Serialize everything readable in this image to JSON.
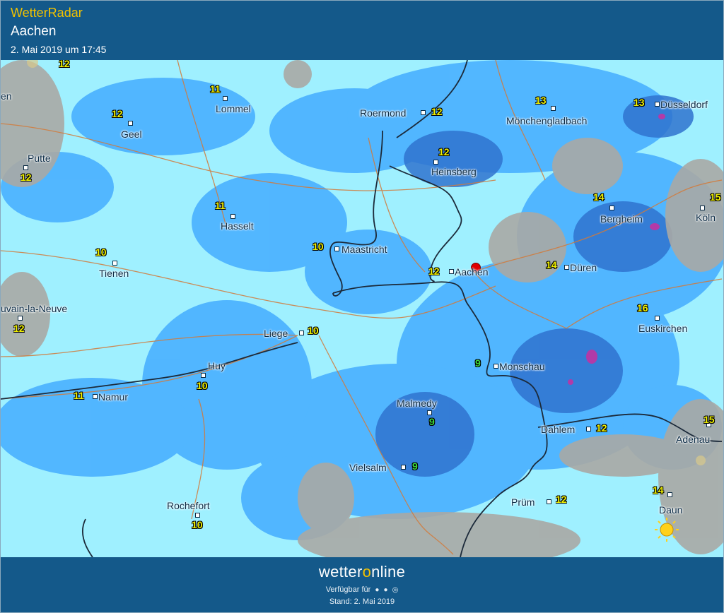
{
  "header": {
    "app_title": "WetterRadar",
    "place": "Aachen",
    "timestamp": "2. Mai 2019 um 17:45"
  },
  "footer": {
    "brand_pre": "wetter",
    "brand_o": "o",
    "brand_post": "nline",
    "available": "Verfügbar für",
    "stand": "Stand: 2. Mai 2019"
  },
  "map": {
    "cities": {
      "lommel": "Lommel",
      "roermond": "Roermond",
      "moenchengladbach": "Mönchengladbach",
      "duesseldorf": "Düsseldorf",
      "geel": "Geel",
      "putte": "Putte",
      "heinsberg": "Heinsberg",
      "hasselt": "Hasselt",
      "bergheim": "Bergheim",
      "koeln": "Köln",
      "maastricht": "Maastricht",
      "tienen": "Tienen",
      "aachen": "Aachen",
      "dueren": "Düren",
      "louvain": "uvain-la-Neuve",
      "euskirchen": "Euskirchen",
      "liege": "Liege",
      "monschau": "Monschau",
      "huy": "Huy",
      "namur": "Namur",
      "malmedy": "Malmedy",
      "dahlem": "Dahlem",
      "adenau": "Adenau",
      "vielsalm": "Vielsalm",
      "pruem": "Prüm",
      "daun": "Daun",
      "rochefort": "Rochefort",
      "en": "en"
    },
    "temps": {
      "t_top": "12",
      "t_lommel": "11",
      "t_roermond": "12",
      "t_mgladbach": "13",
      "t_duesseldorf": "13",
      "t_geel": "12",
      "t_heinsberg": "12",
      "t_putte": "12",
      "t_koeln": "15",
      "t_bergheim": "14",
      "t_hasselt": "11",
      "t_tienen": "10",
      "t_maastricht": "10",
      "t_aachen": "12",
      "t_dueren": "14",
      "t_euskirchen": "16",
      "t_louvain": "12",
      "t_liege": "10",
      "t_monschau": "9",
      "t_huy": "10",
      "t_namur": "11",
      "t_malmedy": "9",
      "t_dahlem": "12",
      "t_adenau": "15",
      "t_vielsalm": "9",
      "t_daun": "14",
      "t_pruem": "12",
      "t_rochefort": "10"
    },
    "icons": {
      "marker": "location-pin",
      "sun": "sun-icon"
    },
    "colors": {
      "light_rain": "#9ff0ff",
      "moderate_rain": "#44aaff",
      "heavy_rain": "#2f73cf",
      "very_heavy": "#b23aa8",
      "dry": "#a9a9a5"
    }
  }
}
